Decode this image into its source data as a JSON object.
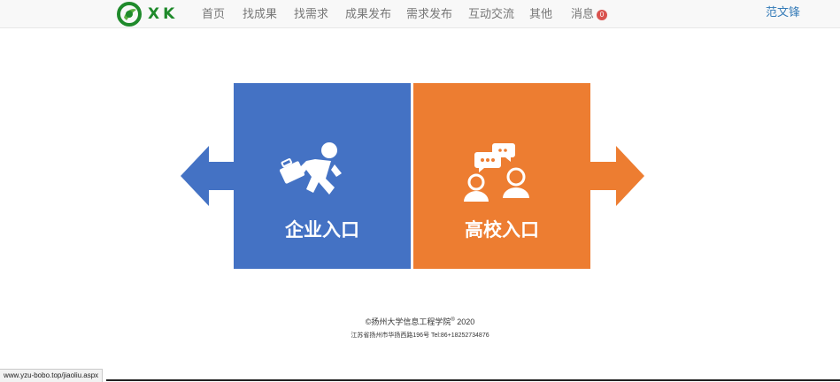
{
  "brand": {
    "logo_text": "XK",
    "accent": "#1f8a2b"
  },
  "nav": {
    "items": [
      {
        "label": "首页"
      },
      {
        "label": "找成果"
      },
      {
        "label": "找需求"
      },
      {
        "label": "成果发布"
      },
      {
        "label": "需求发布"
      },
      {
        "label": "互动交流"
      },
      {
        "label": "其他"
      }
    ],
    "messages_label": "消息",
    "messages_badge": "0",
    "user_name": "范文锋"
  },
  "entries": {
    "enterprise": {
      "label": "企业入口",
      "color": "#4472c4",
      "icon": "running-person-with-briefcase-icon"
    },
    "university": {
      "label": "高校入口",
      "color": "#ed7d31",
      "icon": "two-people-chat-icon"
    }
  },
  "footer": {
    "copyright": "©扬州大学信息工程学院",
    "registered_mark": "®",
    "year": "2020",
    "address": "江苏省扬州市华扬西路196号 Tel:86+18252734876"
  },
  "status_bar": {
    "url": "www.yzu-bobo.top/jiaoliu.aspx"
  }
}
